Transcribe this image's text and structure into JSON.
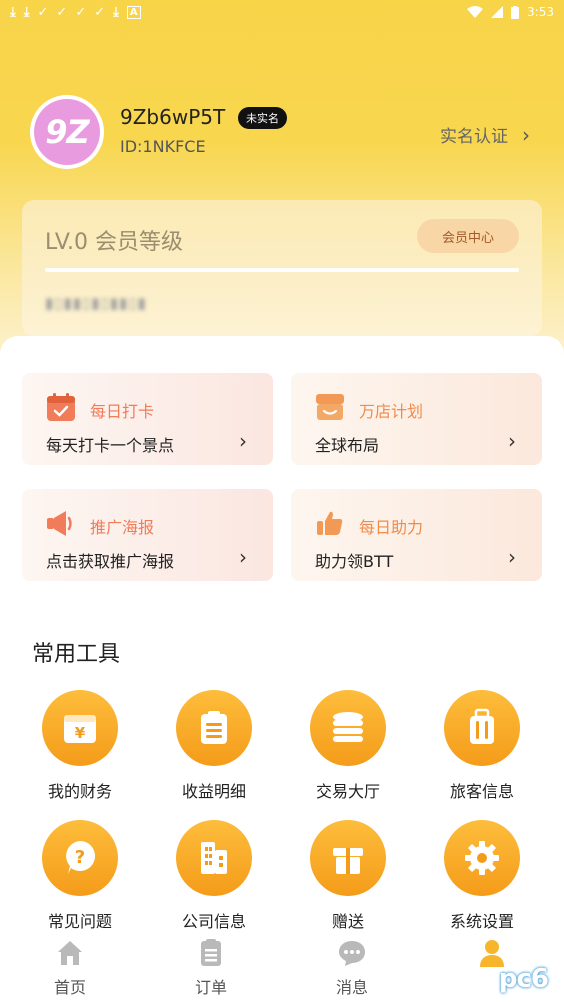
{
  "status_bar": {
    "time": "3:53"
  },
  "profile": {
    "avatar_text": "9Z",
    "username": "9Zb6wP5T",
    "badge": "未实名",
    "user_id": "ID:1NKFCE",
    "verify_label": "实名认证"
  },
  "level_card": {
    "title": "LV.0 会员等级",
    "member_center": "会员中心",
    "progress": 0.0
  },
  "features": [
    {
      "title": "每日打卡",
      "subtitle": "每天打卡一个景点",
      "icon": "calendar-check-icon"
    },
    {
      "title": "万店计划",
      "subtitle": "全球布局",
      "icon": "storefront-icon"
    },
    {
      "title": "推广海报",
      "subtitle": "点击获取推广海报",
      "icon": "megaphone-icon"
    },
    {
      "title": "每日助力",
      "subtitle": "助力领BTT",
      "icon": "thumbs-up-icon"
    }
  ],
  "tools_section": {
    "title": "常用工具"
  },
  "tools": [
    {
      "label": "我的财务",
      "icon": "wallet-yen-icon"
    },
    {
      "label": "收益明细",
      "icon": "clipboard-list-icon"
    },
    {
      "label": "交易大厅",
      "icon": "coin-stack-icon"
    },
    {
      "label": "旅客信息",
      "icon": "luggage-icon"
    },
    {
      "label": "常见问题",
      "icon": "question-bubble-icon"
    },
    {
      "label": "公司信息",
      "icon": "building-icon"
    },
    {
      "label": "赠送",
      "icon": "gift-icon"
    },
    {
      "label": "系统设置",
      "icon": "gear-icon"
    }
  ],
  "tabbar": [
    {
      "label": "首页",
      "icon": "home-icon"
    },
    {
      "label": "订单",
      "icon": "order-list-icon"
    },
    {
      "label": "消息",
      "icon": "chat-bubble-icon"
    },
    {
      "label": "我的",
      "icon": "user-icon"
    }
  ],
  "colors": {
    "header_yellow": "#f8d449",
    "tool_orange": "#f7a928",
    "feature_red": "#f07c5a",
    "feature_orange": "#f08c4a"
  }
}
